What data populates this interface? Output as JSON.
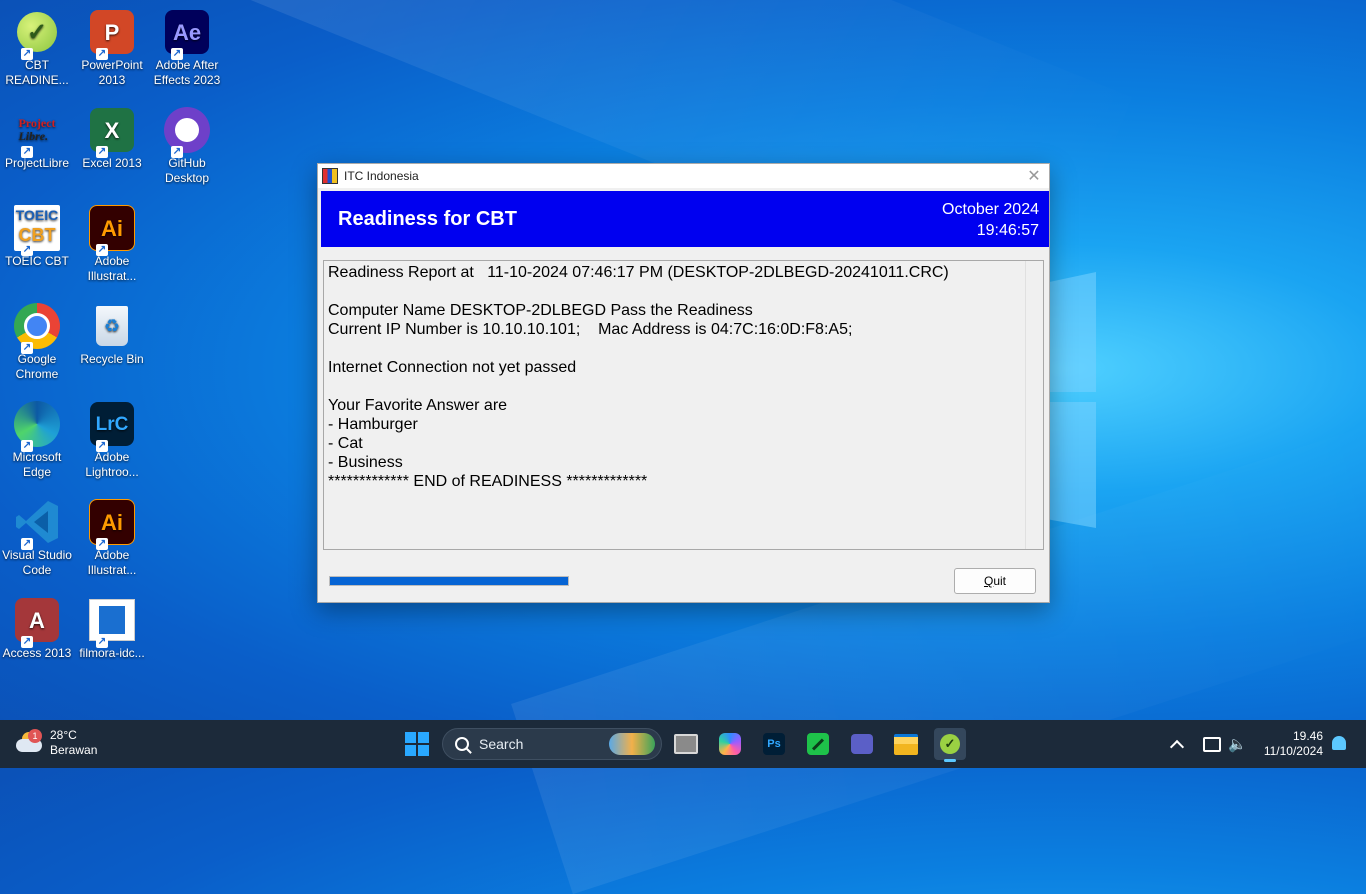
{
  "desktop_icons": [
    {
      "label": "CBT READINE...",
      "icon": "cbt-check-icon"
    },
    {
      "label": "PowerPoint 2013",
      "icon": "powerpoint-icon"
    },
    {
      "label": "Adobe After Effects 2023",
      "icon": "after-effects-icon"
    },
    {
      "label": "ProjectLibre",
      "icon": "projectlibre-icon"
    },
    {
      "label": "Excel 2013",
      "icon": "excel-icon"
    },
    {
      "label": "GitHub Desktop",
      "icon": "github-icon"
    },
    {
      "label": "TOEIC CBT",
      "icon": "toeic-icon"
    },
    {
      "label": "Adobe Illustrat...",
      "icon": "illustrator-icon"
    },
    {
      "label": "Google Chrome",
      "icon": "chrome-icon"
    },
    {
      "label": "Recycle Bin",
      "icon": "recycle-bin-icon"
    },
    {
      "label": "Microsoft Edge",
      "icon": "edge-icon"
    },
    {
      "label": "Adobe Lightroo...",
      "icon": "lightroom-icon"
    },
    {
      "label": "Visual Studio Code",
      "icon": "vscode-icon"
    },
    {
      "label": "Adobe Illustrat...",
      "icon": "illustrator-icon"
    },
    {
      "label": "Access 2013",
      "icon": "access-icon"
    },
    {
      "label": "filmora-idc...",
      "icon": "file-icon"
    }
  ],
  "icon_glyphs": {
    "ppt": "P",
    "ae": "Ae",
    "excel": "X",
    "ai": "Ai",
    "lrc": "LrC",
    "access": "A",
    "projectlibre_1": "Project",
    "projectlibre_2": "Libre.",
    "toeic_1": "TOEIC",
    "toeic_2": "CBT"
  },
  "dialog": {
    "window_title": "ITC Indonesia",
    "banner_title": "Readiness for CBT",
    "banner_date": "October 2024",
    "banner_time": "19:46:57",
    "report_lines": [
      "Readiness Report at   11-10-2024 07:46:17 PM (DESKTOP-2DLBEGD-20241011.CRC)",
      "",
      "Computer Name DESKTOP-2DLBEGD Pass the Readiness",
      "Current IP Number is 10.10.10.101;    Mac Address is 04:7C:16:0D:F8:A5;",
      "",
      "Internet Connection not yet passed",
      "",
      "Your Favorite Answer are",
      "- Hamburger",
      "- Cat",
      "- Business",
      "************* END of READINESS *************"
    ],
    "progress_fraction": 1.0,
    "quit_label_underlined": "Q",
    "quit_label_rest": "uit"
  },
  "taskbar": {
    "weather_temp": "28°C",
    "weather_desc": "Berawan",
    "weather_badge": "1",
    "search_label": "Search",
    "apps": [
      "task-view-icon",
      "copilot-icon",
      "photoshop-icon",
      "app-green-icon",
      "teams-icon",
      "file-explorer-icon",
      "cbt-readiness-icon"
    ],
    "ps_glyph": "Ps",
    "clock_time": "19.46",
    "clock_date": "11/10/2024"
  },
  "colors": {
    "banner_blue": "#0000f0",
    "progress_blue": "#0664d4",
    "taskbar": "#1c2a3a"
  }
}
